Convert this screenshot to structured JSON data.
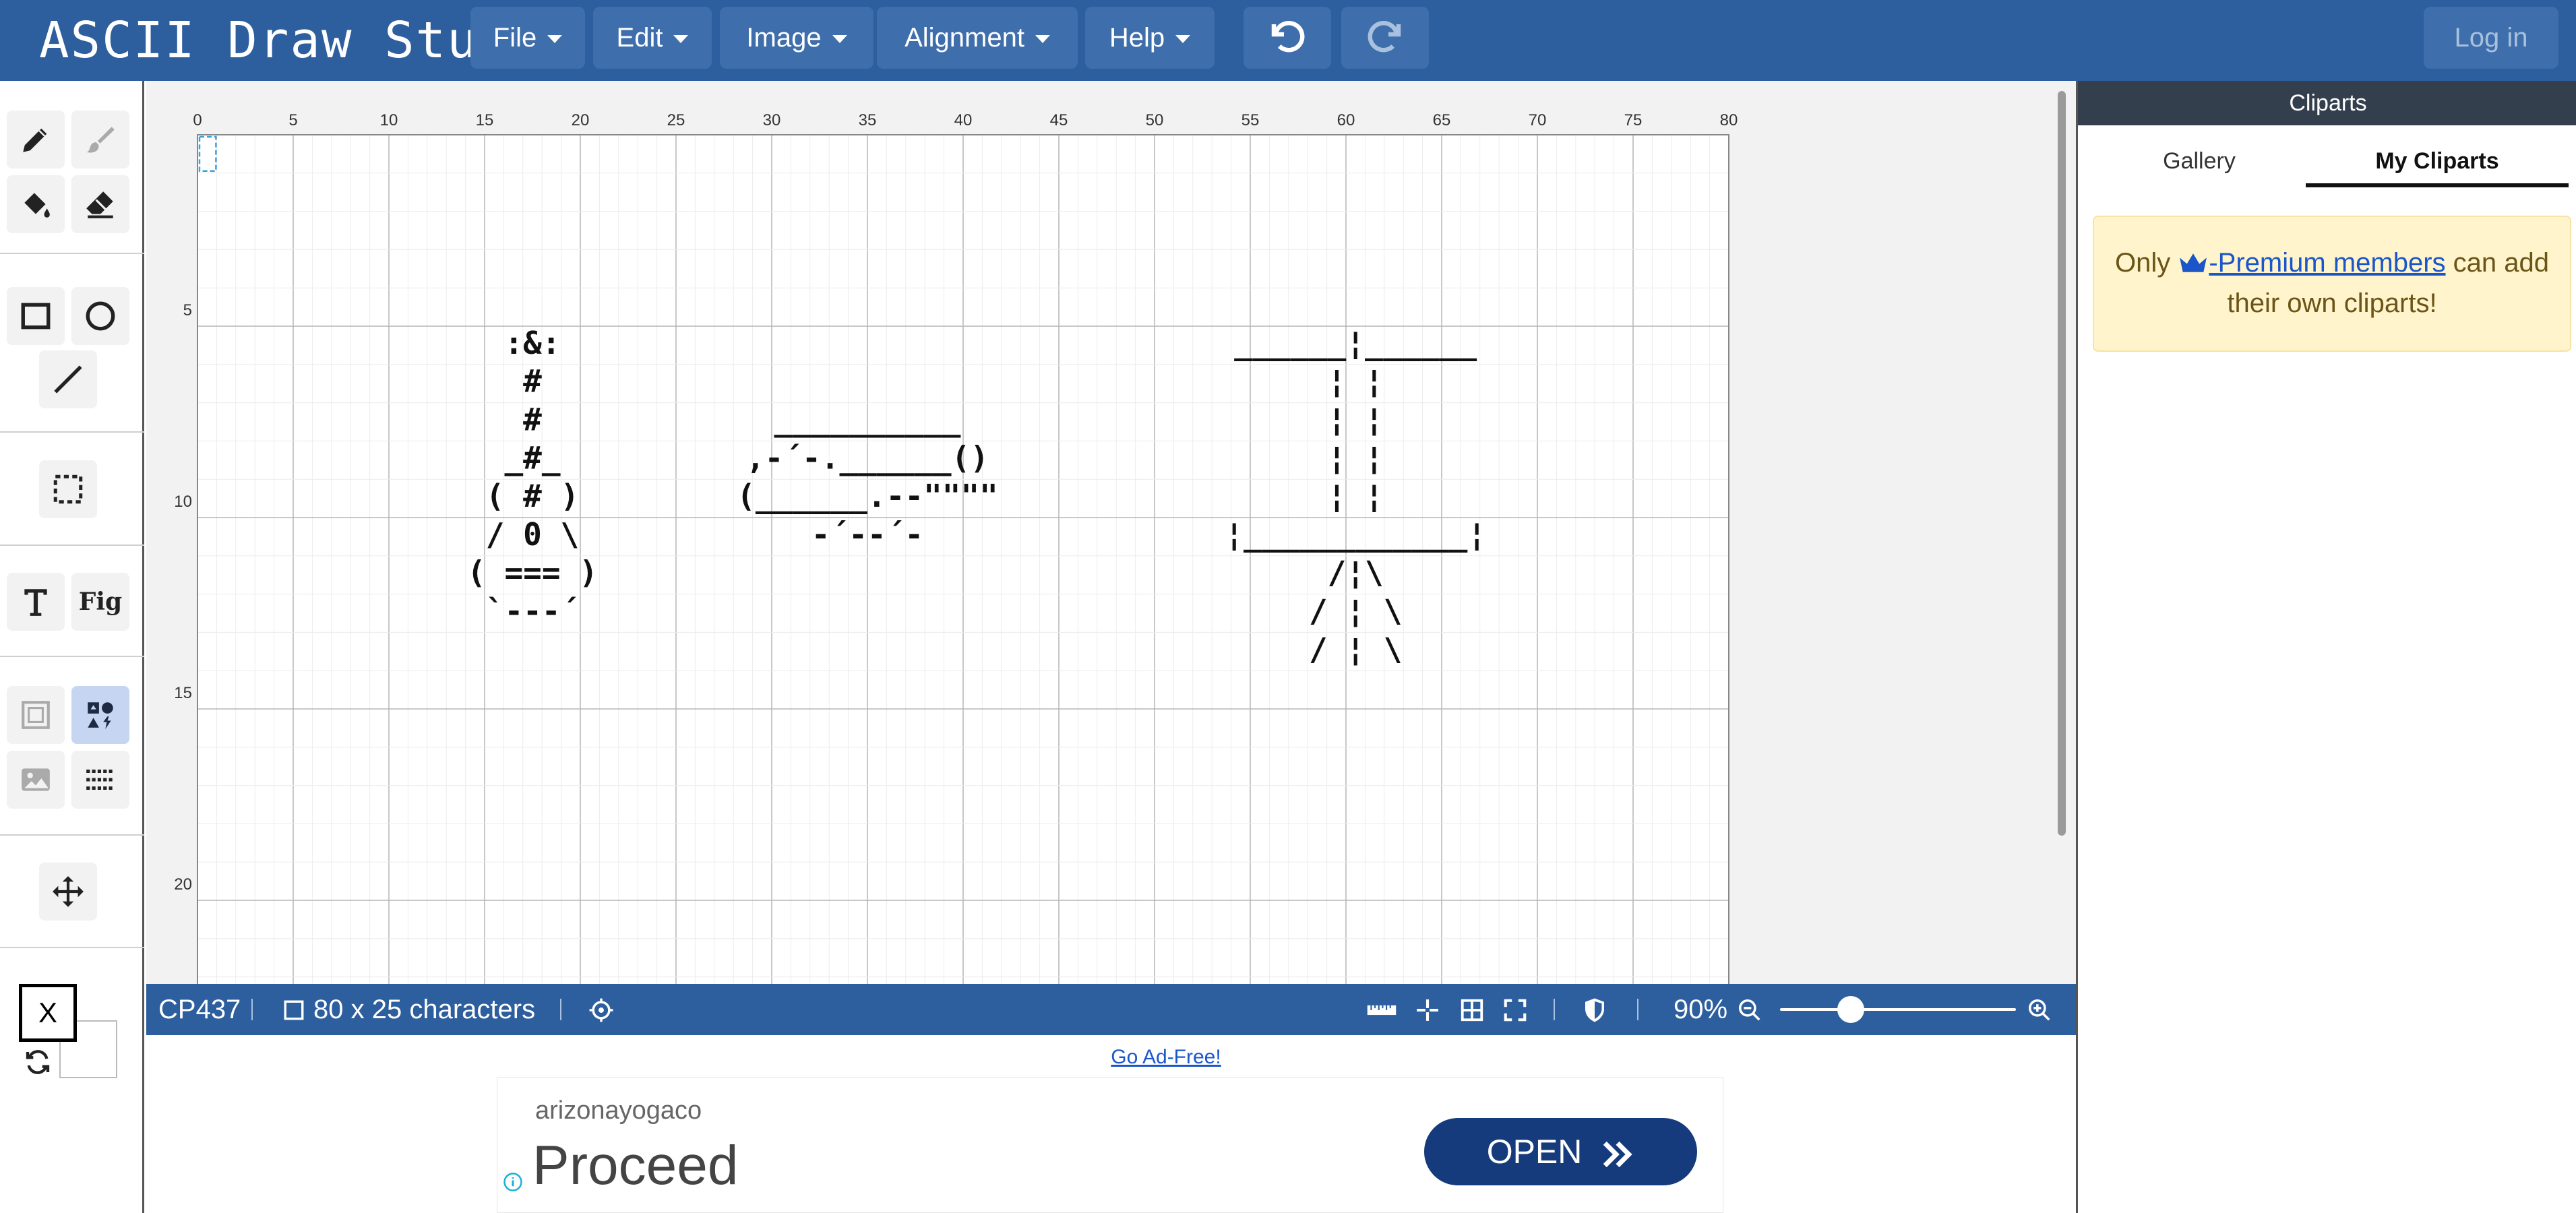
{
  "app": {
    "title": "ASCII Draw Studio"
  },
  "menu": [
    {
      "label": "File"
    },
    {
      "label": "Edit"
    },
    {
      "label": "Image"
    },
    {
      "label": "Alignment"
    },
    {
      "label": "Help"
    }
  ],
  "history": {
    "undo_icon": "undo-icon",
    "redo_icon": "redo-icon"
  },
  "auth": {
    "login_label": "Log in"
  },
  "tools": {
    "pencil": "pencil-icon",
    "brush": "brush-icon",
    "fill": "paint-bucket-icon",
    "eraser": "eraser-icon",
    "rectangle": "rectangle-icon",
    "ellipse": "ellipse-icon",
    "line": "line-icon",
    "select": "selection-icon",
    "text": "text-icon",
    "figlet_label": "Fig",
    "frame": "frame-icon",
    "cliparts": "cliparts-icon",
    "image": "image-icon",
    "pattern": "pattern-icon",
    "move": "move-icon",
    "foreground_char": "X",
    "active_tool": "cliparts"
  },
  "ruler": {
    "x_ticks": [
      "0",
      "5",
      "10",
      "15",
      "20",
      "25",
      "30",
      "35",
      "40",
      "45",
      "50",
      "55",
      "60",
      "65",
      "70",
      "75",
      "80"
    ],
    "y_ticks": [
      "5",
      "10",
      "15",
      "20"
    ]
  },
  "artwork": {
    "lamp": [
      ":&:",
      "#",
      "#",
      "_#_",
      "( # )",
      "/ 0 \\",
      "( === )",
      "`---´"
    ],
    "teapot": [
      "__________",
      ",-´-.______()",
      "(______.--\"\"\"\"",
      "-´--´-"
    ],
    "easel": [
      "______¦______",
      "¦            ¦",
      "¦            ¦",
      "¦            ¦",
      "¦            ¦",
      "¦____________¦",
      "/¦\\",
      "/ ¦ \\",
      "/  ¦  \\"
    ]
  },
  "status": {
    "encoding": "CP437",
    "size": "80 x 25 characters",
    "zoom": "90%",
    "zoom_level": 0.3,
    "icons": [
      "target-icon",
      "ruler-icon",
      "crosshair-icon",
      "grid-icon",
      "fullscreen-icon",
      "shield-icon",
      "zoom-out-icon",
      "zoom-in-icon"
    ]
  },
  "ad": {
    "adfree_label": "Go Ad-Free!",
    "domain": "arizonayogaco",
    "headline": "Proceed",
    "cta_label": "OPEN",
    "cta_icon": "double-chevron-icon",
    "info_icon": "info-icon"
  },
  "panel": {
    "title": "Cliparts",
    "tabs": [
      {
        "label": "Gallery"
      },
      {
        "label": "My Cliparts"
      }
    ],
    "active_tab": "My Cliparts",
    "note_prefix": "Only ",
    "note_link": "-Premium members",
    "note_suffix": " can add their own cliparts!",
    "note_icon": "crown-icon"
  },
  "colors": {
    "brand": "#2d5f9e",
    "panel_header": "#343f4e",
    "active_tool_bg": "#c6d6f2",
    "link": "#1a56c9",
    "note_bg": "#fff4cc",
    "cta_bg": "#153b7c"
  }
}
